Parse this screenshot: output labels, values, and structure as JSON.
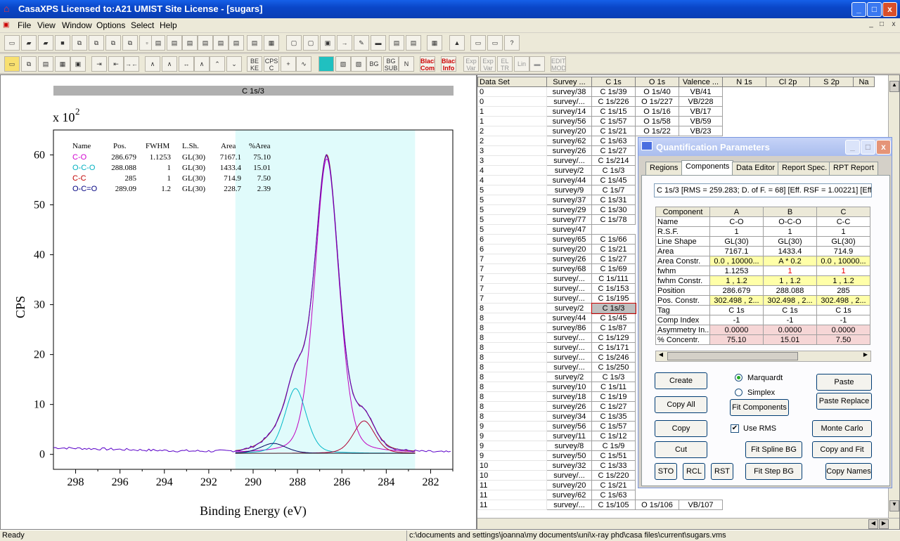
{
  "window": {
    "title": "CasaXPS Licensed to:A21 UMIST Site License  - [sugars]",
    "min": "_",
    "max": "□",
    "close": "x"
  },
  "menu": [
    "File",
    "View",
    "Window",
    "Options",
    "Select",
    "Help"
  ],
  "mdi": [
    "_",
    "□",
    "x"
  ],
  "toolbar1": [
    "",
    "",
    "",
    "",
    "",
    "",
    "",
    "",
    "",
    "",
    "",
    "",
    "",
    "",
    "",
    "",
    "",
    "",
    "",
    "",
    "",
    "",
    "",
    "",
    "",
    "",
    "",
    "",
    "",
    "",
    ""
  ],
  "toolbar2": [
    "BE KE",
    "CPS C",
    "BG",
    "BG SUB",
    "Black Com",
    "Black Info",
    "Exp Var",
    "Exp Var",
    "EL TR",
    "Lin",
    "",
    "EDIT MODE"
  ],
  "spectrum": {
    "header": "C 1s/3",
    "exponent": "x 10",
    "exponent_power": "2",
    "ylabel": "CPS",
    "xlabel": "Binding Energy (eV)",
    "table_header": [
      "Name",
      "Pos.",
      "FWHM",
      "L.Sh.",
      "Area",
      "%Area"
    ],
    "table_rows": [
      {
        "name": "C-O",
        "pos": "286.679",
        "fwhm": "1.1253",
        "lsh": "GL(30)",
        "area": "7167.1",
        "pct": "75.10",
        "color": "#d000d0"
      },
      {
        "name": "O-C-O",
        "pos": "288.088",
        "fwhm": "1",
        "lsh": "GL(30)",
        "area": "1433.4",
        "pct": "15.01",
        "color": "#00b0c0"
      },
      {
        "name": "C-C",
        "pos": "285",
        "fwhm": "1",
        "lsh": "GL(30)",
        "area": "714.9",
        "pct": "7.50",
        "color": "#c00000"
      },
      {
        "name": "O-C=O",
        "pos": "289.09",
        "fwhm": "1.2",
        "lsh": "GL(30)",
        "area": "228.7",
        "pct": "2.39",
        "color": "#000080"
      }
    ],
    "xticks": [
      "298",
      "296",
      "294",
      "292",
      "290",
      "288",
      "286",
      "284",
      "282"
    ],
    "yticks": [
      "0",
      "10",
      "20",
      "30",
      "40",
      "50",
      "60"
    ]
  },
  "chart_data": {
    "type": "line",
    "title": "C 1s/3",
    "xlabel": "Binding Energy (eV)",
    "ylabel": "CPS",
    "y_multiplier": "x 10^2",
    "xlim": [
      299,
      281
    ],
    "ylim": [
      -3,
      65
    ],
    "region_xlim": [
      290.8,
      282.7
    ],
    "components": [
      {
        "name": "C-O",
        "center": 286.679,
        "fwhm": 1.1253,
        "height": 59,
        "color": "#c000c0"
      },
      {
        "name": "O-C-O",
        "center": 288.088,
        "fwhm": 1.0,
        "height": 13,
        "color": "#00b8c8"
      },
      {
        "name": "C-C",
        "center": 285.0,
        "fwhm": 1.0,
        "height": 6.5,
        "color": "#b00030"
      },
      {
        "name": "O-C=O",
        "center": 289.09,
        "fwhm": 1.2,
        "height": 2.0,
        "color": "#000060"
      }
    ],
    "background_level": 0.2,
    "left_noise_level": 1.3
  },
  "browser": {
    "headers": [
      "Data Set",
      "Survey ...",
      "C 1s",
      "O 1s",
      "Valence ...",
      "N 1s",
      "Cl 2p",
      "S 2p",
      "Na"
    ],
    "rows": [
      [
        "0",
        "survey/38",
        "C 1s/39",
        "O 1s/40",
        "VB/41"
      ],
      [
        "0",
        "survey/...",
        "C 1s/226",
        "O 1s/227",
        "VB/228"
      ],
      [
        "1",
        "survey/14",
        "C 1s/15",
        "O 1s/16",
        "VB/17"
      ],
      [
        "1",
        "survey/56",
        "C 1s/57",
        "O 1s/58",
        "VB/59"
      ],
      [
        "2",
        "survey/20",
        "C 1s/21",
        "O 1s/22",
        "VB/23"
      ],
      [
        "2",
        "survey/62",
        "C 1s/63",
        "",
        ""
      ],
      [
        "3",
        "survey/26",
        "C 1s/27",
        "",
        ""
      ],
      [
        "3",
        "survey/...",
        "C 1s/214",
        "",
        ""
      ],
      [
        "4",
        "survey/2",
        "C 1s/3",
        "",
        ""
      ],
      [
        "4",
        "survey/44",
        "C 1s/45",
        "",
        ""
      ],
      [
        "5",
        "survey/9",
        "C 1s/7",
        "",
        ""
      ],
      [
        "5",
        "survey/37",
        "C 1s/31",
        "",
        ""
      ],
      [
        "5",
        "survey/29",
        "C 1s/30",
        "",
        ""
      ],
      [
        "5",
        "survey/77",
        "C 1s/78",
        "",
        ""
      ],
      [
        "5",
        "survey/47",
        "",
        "",
        ""
      ],
      [
        "6",
        "survey/65",
        "C 1s/66",
        "",
        ""
      ],
      [
        "6",
        "survey/20",
        "C 1s/21",
        "",
        ""
      ],
      [
        "7",
        "survey/26",
        "C 1s/27",
        "",
        ""
      ],
      [
        "7",
        "survey/68",
        "C 1s/69",
        "",
        ""
      ],
      [
        "7",
        "survey/...",
        "C 1s/111",
        "",
        ""
      ],
      [
        "7",
        "survey/...",
        "C 1s/153",
        "",
        ""
      ],
      [
        "7",
        "survey/...",
        "C 1s/195",
        "",
        ""
      ],
      [
        "8",
        "survey/2",
        "C 1s/3",
        "",
        ""
      ],
      [
        "8",
        "survey/44",
        "C 1s/45",
        "",
        ""
      ],
      [
        "8",
        "survey/86",
        "C 1s/87",
        "",
        ""
      ],
      [
        "8",
        "survey/...",
        "C 1s/129",
        "",
        ""
      ],
      [
        "8",
        "survey/...",
        "C 1s/171",
        "",
        ""
      ],
      [
        "8",
        "survey/...",
        "C 1s/246",
        "",
        ""
      ],
      [
        "8",
        "survey/...",
        "C 1s/250",
        "",
        ""
      ],
      [
        "8",
        "survey/2",
        "C 1s/3",
        "",
        ""
      ],
      [
        "8",
        "survey/10",
        "C 1s/11",
        "",
        ""
      ],
      [
        "8",
        "survey/18",
        "C 1s/19",
        "",
        ""
      ],
      [
        "8",
        "survey/26",
        "C 1s/27",
        "",
        ""
      ],
      [
        "8",
        "survey/34",
        "C 1s/35",
        "",
        ""
      ],
      [
        "9",
        "survey/56",
        "C 1s/57",
        "",
        ""
      ],
      [
        "9",
        "survey/11",
        "C 1s/12",
        "",
        ""
      ],
      [
        "9",
        "survey/8",
        "C 1s/9",
        "",
        ""
      ],
      [
        "9",
        "survey/50",
        "C 1s/51",
        "",
        ""
      ],
      [
        "10",
        "survey/32",
        "C 1s/33",
        "",
        ""
      ],
      [
        "10",
        "survey/...",
        "C 1s/220",
        "",
        ""
      ],
      [
        "11",
        "survey/20",
        "C 1s/21",
        "",
        ""
      ],
      [
        "11",
        "survey/62",
        "C 1s/63",
        "",
        ""
      ],
      [
        "11",
        "survey/...",
        "C 1s/105",
        "O 1s/106",
        "VB/107"
      ]
    ]
  },
  "dialog": {
    "title": "Quantification Parameters",
    "tabs": [
      "Regions",
      "Components",
      "Data Editor",
      "Report Spec.",
      "RPT Report"
    ],
    "info": "C 1s/3 [RMS = 259.283; D. of F. = 68] [Eff. RSF = 1.00221] [Eff.",
    "table_headers": [
      "Component",
      "A",
      "B",
      "C"
    ],
    "table_rows": [
      {
        "label": "Name",
        "a": "C-O",
        "b": "O-C-O",
        "c": "C-C",
        "cls": ""
      },
      {
        "label": "R.S.F.",
        "a": "1",
        "b": "1",
        "c": "1",
        "cls": ""
      },
      {
        "label": "Line Shape",
        "a": "GL(30)",
        "b": "GL(30)",
        "c": "GL(30)",
        "cls": ""
      },
      {
        "label": "Area",
        "a": "7167.1",
        "b": "1433.4",
        "c": "714.9",
        "cls": ""
      },
      {
        "label": "Area Constr.",
        "a": "0.0 , 10000...",
        "b": "A * 0.2",
        "c": "0.0 , 10000...",
        "cls": "y"
      },
      {
        "label": "fwhm",
        "a": "1.1253",
        "b": "1",
        "c": "1",
        "cls": "redbc"
      },
      {
        "label": "fwhm Constr.",
        "a": "1 , 1.2",
        "b": "1 , 1.2",
        "c": "1 , 1.2",
        "cls": "y"
      },
      {
        "label": "Position",
        "a": "286.679",
        "b": "288.088",
        "c": "285",
        "cls": ""
      },
      {
        "label": "Pos. Constr.",
        "a": "302.498 , 2...",
        "b": "302.498 , 2...",
        "c": "302.498 , 2...",
        "cls": "y"
      },
      {
        "label": "Tag",
        "a": "C 1s",
        "b": "C 1s",
        "c": "C 1s",
        "cls": ""
      },
      {
        "label": "Comp Index",
        "a": "-1",
        "b": "-1",
        "c": "-1",
        "cls": ""
      },
      {
        "label": "Asymmetry In...",
        "a": "0.0000",
        "b": "0.0000",
        "c": "0.0000",
        "cls": "p"
      },
      {
        "label": "% Concentr.",
        "a": "75.10",
        "b": "15.01",
        "c": "7.50",
        "cls": "p"
      }
    ],
    "buttons": {
      "create": "Create",
      "copy_all": "Copy All",
      "copy": "Copy",
      "cut": "Cut",
      "sto": "STO",
      "rcl": "RCL",
      "rst": "RST",
      "fit_components": "Fit Components",
      "fit_spline_bg": "Fit Spline BG",
      "fit_step_bg": "Fit Step BG",
      "paste": "Paste",
      "paste_replace": "Paste Replace",
      "monte_carlo": "Monte Carlo",
      "copy_and_fit": "Copy and Fit",
      "copy_names": "Copy Names"
    },
    "radio_marquardt": "Marquardt",
    "radio_simplex": "Simplex",
    "use_rms": "Use RMS"
  },
  "status": {
    "left": "Ready",
    "path": "c:\\documents and settings\\joanna\\my documents\\uni\\x-ray phd\\casa files\\current\\sugars.vms"
  }
}
